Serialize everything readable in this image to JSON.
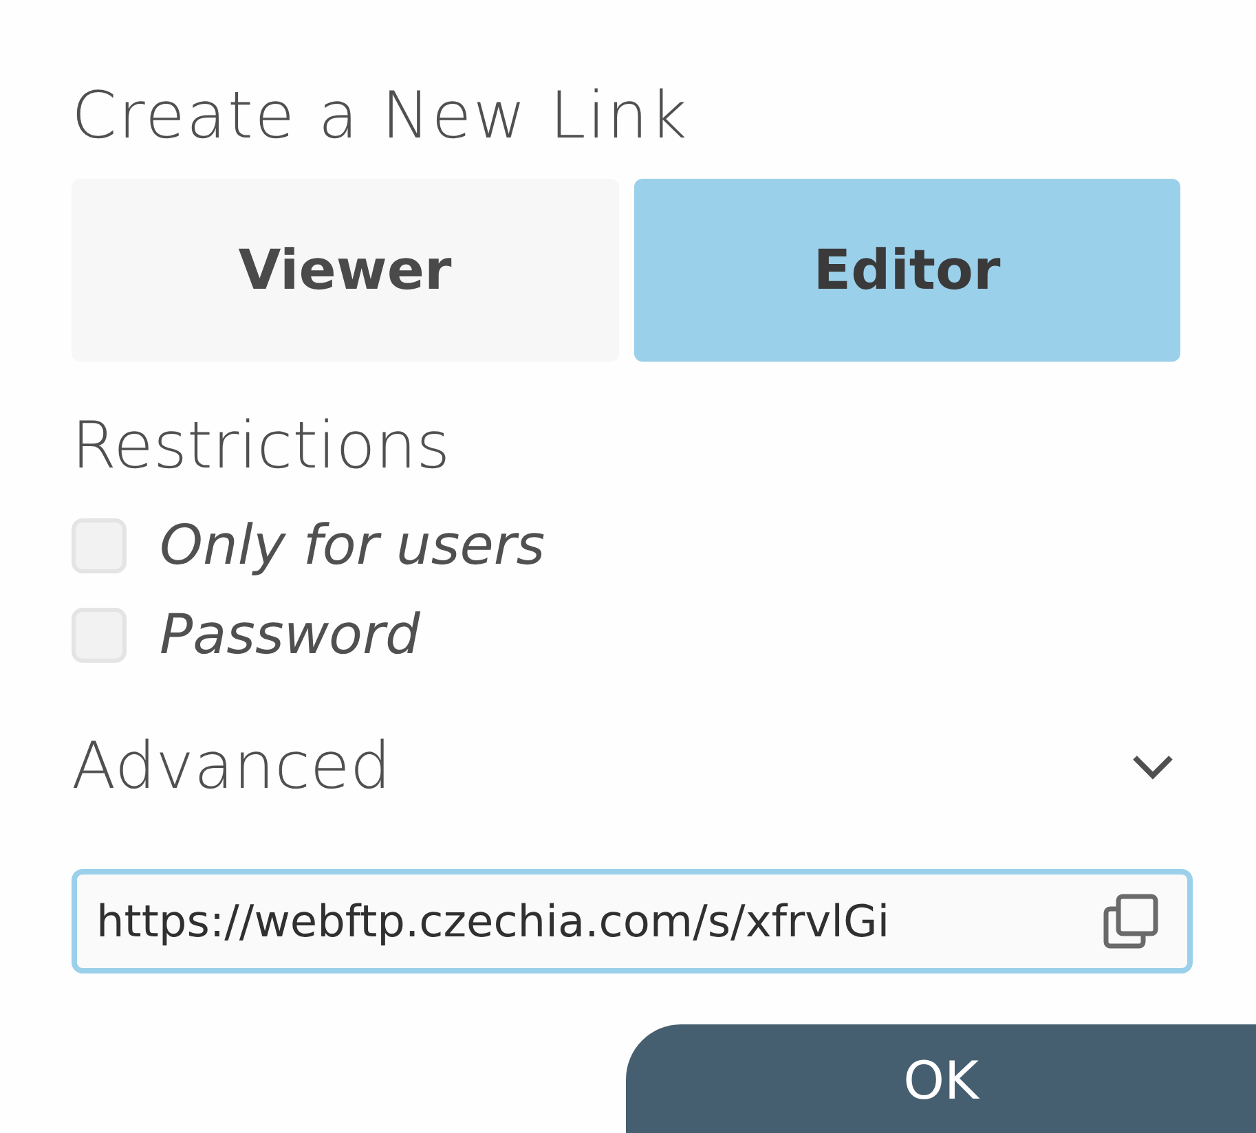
{
  "title": "Create a New Link",
  "tabs": [
    {
      "label": "Viewer",
      "selected": false
    },
    {
      "label": "Editor",
      "selected": true
    }
  ],
  "restrictions": {
    "heading": "Restrictions",
    "options": [
      {
        "label": "Only for users",
        "checked": false
      },
      {
        "label": "Password",
        "checked": false
      }
    ]
  },
  "advanced": {
    "heading": "Advanced",
    "expanded": false
  },
  "link_field": {
    "value": "https://webftp.czechia.com/s/xfrvlGi"
  },
  "ok_button": {
    "label": "OK"
  }
}
